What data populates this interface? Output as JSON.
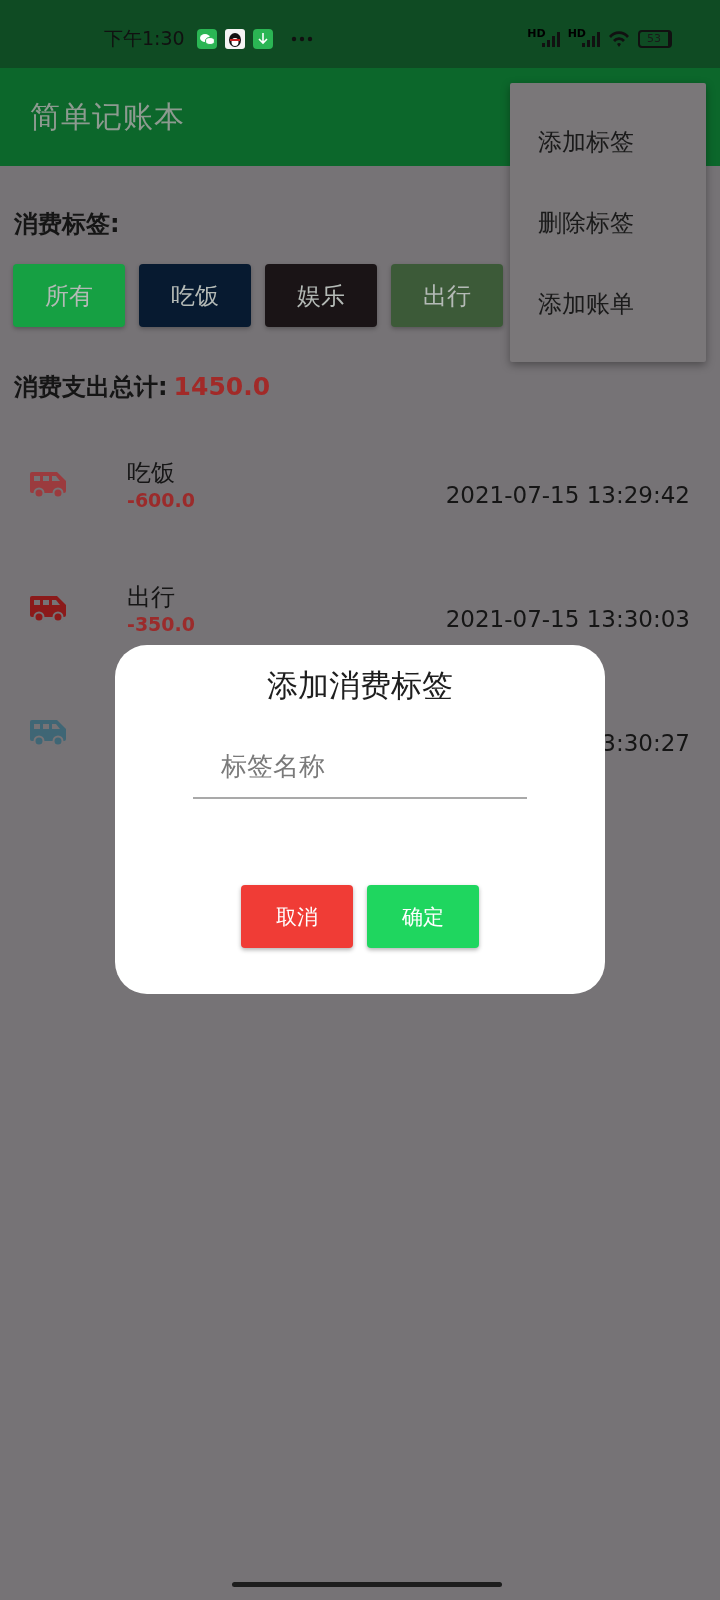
{
  "status_bar": {
    "time": "下午1:30",
    "signal_labels": [
      "HD",
      "HD"
    ],
    "battery": "53"
  },
  "app_bar": {
    "title": "简单记账本"
  },
  "menu": {
    "items": [
      {
        "label": "添加标签"
      },
      {
        "label": "删除标签"
      },
      {
        "label": "添加账单"
      }
    ]
  },
  "tags_label": "消费标签:",
  "tags": [
    {
      "label": "所有",
      "color": "#16a043"
    },
    {
      "label": "吃饭",
      "color": "#071a30"
    },
    {
      "label": "娱乐",
      "color": "#1a1416"
    },
    {
      "label": "出行",
      "color": "#3c5a38"
    }
  ],
  "total": {
    "label": "消费支出总计:",
    "amount": "1450.0"
  },
  "bills": [
    {
      "name": "吃饭",
      "amount": "-600.0",
      "time": "2021-07-15 13:29:42",
      "color": "#9b3b3e"
    },
    {
      "name": "出行",
      "amount": "-350.0",
      "time": "2021-07-15 13:30:03",
      "color": "#8b1a1a"
    },
    {
      "time": "3:30:27",
      "color": "#3f6675"
    }
  ],
  "dialog": {
    "title": "添加消费标签",
    "field": {
      "placeholder": "标签名称"
    },
    "buttons": [
      {
        "label": "取消",
        "kind": "cancel"
      },
      {
        "label": "确定",
        "kind": "confirm"
      }
    ]
  }
}
